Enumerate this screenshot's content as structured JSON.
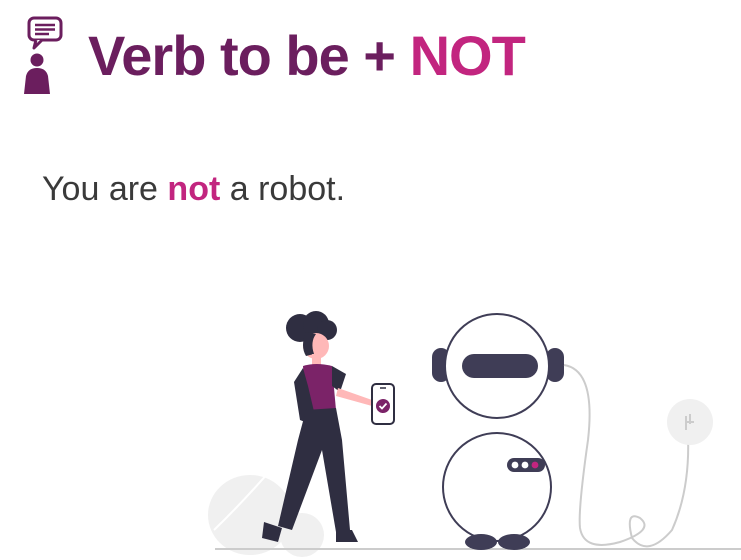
{
  "title": {
    "part1": "Verb to be + ",
    "part2": "NOT"
  },
  "sentence": {
    "before": "You are ",
    "negation": "not",
    "after": " a robot."
  },
  "colors": {
    "primary": "#6b1e5e",
    "accent": "#c2257f",
    "text": "#3a3a3a",
    "dark": "#2f2e41"
  },
  "icons": [
    "speaker-chat-icon",
    "phone-check-icon"
  ]
}
